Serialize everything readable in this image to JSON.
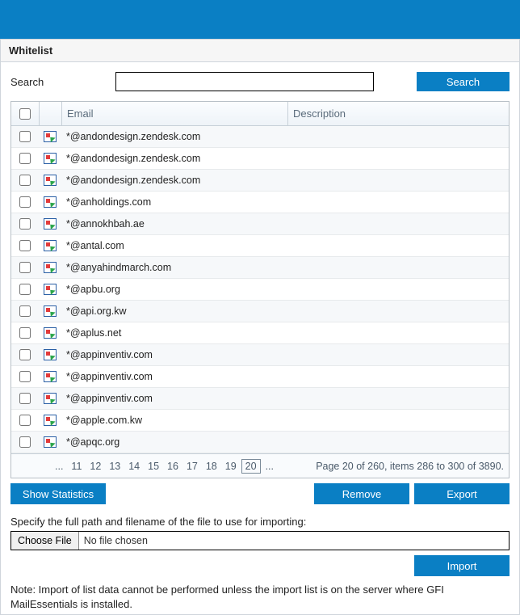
{
  "header": {
    "title": "Whitelist"
  },
  "search": {
    "label": "Search",
    "value": "",
    "button": "Search"
  },
  "table": {
    "columns": {
      "email": "Email",
      "description": "Description"
    },
    "rows": [
      {
        "email": "*@andondesign.zendesk.com",
        "description": ""
      },
      {
        "email": "*@andondesign.zendesk.com",
        "description": ""
      },
      {
        "email": "*@andondesign.zendesk.com",
        "description": ""
      },
      {
        "email": "*@anholdings.com",
        "description": ""
      },
      {
        "email": "*@annokhbah.ae",
        "description": ""
      },
      {
        "email": "*@antal.com",
        "description": ""
      },
      {
        "email": "*@anyahindmarch.com",
        "description": ""
      },
      {
        "email": "*@apbu.org",
        "description": ""
      },
      {
        "email": "*@api.org.kw",
        "description": ""
      },
      {
        "email": "*@aplus.net",
        "description": ""
      },
      {
        "email": "*@appinventiv.com",
        "description": ""
      },
      {
        "email": "*@appinventiv.com",
        "description": ""
      },
      {
        "email": "*@appinventiv.com",
        "description": ""
      },
      {
        "email": "*@apple.com.kw",
        "description": ""
      },
      {
        "email": "*@apqc.org",
        "description": ""
      }
    ],
    "pager": {
      "leading_ellipsis": "...",
      "pages": [
        "11",
        "12",
        "13",
        "14",
        "15",
        "16",
        "17",
        "18",
        "19",
        "20"
      ],
      "current": "20",
      "trailing_ellipsis": "...",
      "info": "Page 20 of 260, items 286 to 300 of 3890."
    }
  },
  "actions": {
    "show_statistics": "Show Statistics",
    "remove": "Remove",
    "export": "Export"
  },
  "import": {
    "instruction": "Specify the full path and filename of the file to use for importing:",
    "choose_button": "Choose File",
    "no_file": "No file chosen",
    "import_button": "Import"
  },
  "note": "Note: Import of list data cannot be performed unless the import list is on the server where GFI MailEssentials is installed."
}
